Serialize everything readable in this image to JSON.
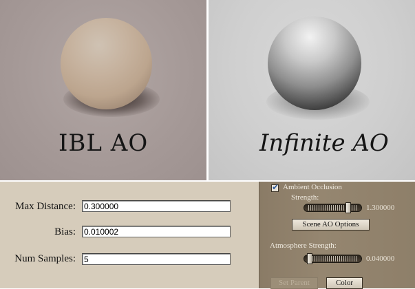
{
  "renders": {
    "ibl": {
      "caption": "IBL AO"
    },
    "infinite": {
      "caption": "Infinite AO"
    }
  },
  "ao_settings": {
    "max_distance": {
      "label": "Max Distance:",
      "value": "0.300000"
    },
    "bias": {
      "label": "Bias:",
      "value": "0.010002"
    },
    "num_samples": {
      "label": "Num Samples:",
      "value": "5"
    }
  },
  "render_panel": {
    "ambient_occlusion": {
      "label": "Ambient Occlusion",
      "checked": true
    },
    "strength": {
      "label": "Strength:",
      "value": "1.300000",
      "level": 0.8
    },
    "scene_ao_options_button": "Scene AO Options",
    "atmosphere_strength": {
      "label": "Atmosphere Strength:",
      "value": "0.040000",
      "level": 0.05
    },
    "set_parent_button": "Set Parent",
    "color_button": "Color"
  },
  "colors": {
    "ibl_background": "#a59997",
    "infinite_background": "#cfcfcf",
    "settings_background": "#d6ccbb",
    "panel_background": "#8e7f69"
  }
}
